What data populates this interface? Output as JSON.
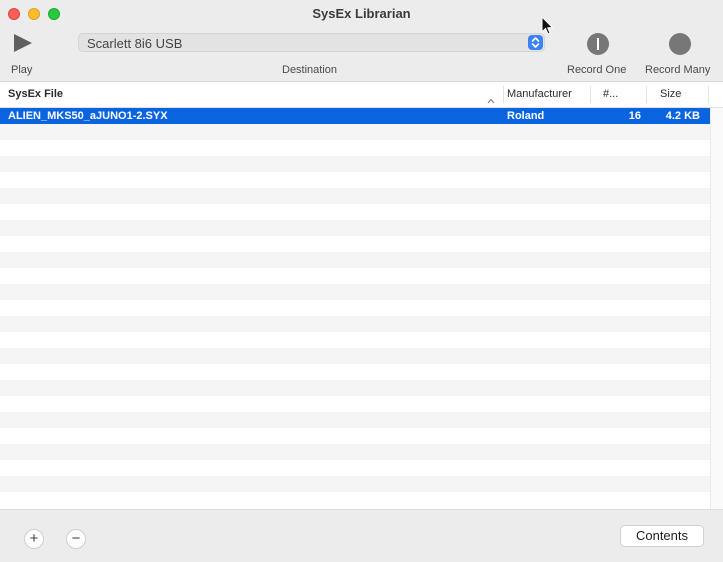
{
  "window": {
    "title": "SysEx Librarian"
  },
  "toolbar": {
    "play_label": "Play",
    "destination_label": "Destination",
    "destination_value": "Scarlett 8i6 USB",
    "record_one_label": "Record One",
    "record_many_label": "Record Many"
  },
  "table": {
    "columns": [
      "SysEx File",
      "Manufacturer",
      "#...",
      "Size"
    ],
    "sort_column": "SysEx File",
    "sort_direction": "ascending",
    "rows": [
      {
        "file": "ALIEN_MKS50_aJUNO1-2.SYX",
        "manufacturer": "Roland",
        "count": "16",
        "size": "4.2 KB",
        "selected": true
      }
    ]
  },
  "footer": {
    "add_label": "+",
    "remove_label": "−",
    "contents_label": "Contents"
  },
  "colors": {
    "selection": "#0a64e0",
    "stepper": "#3b82f6",
    "close": "#fe5f57",
    "minimize": "#febc2e",
    "zoom": "#28c840"
  },
  "icons": [
    "play-icon",
    "record-one-icon",
    "record-many-icon",
    "sort-ascending-icon",
    "popup-stepper-icon",
    "pointer-cursor-icon"
  ]
}
